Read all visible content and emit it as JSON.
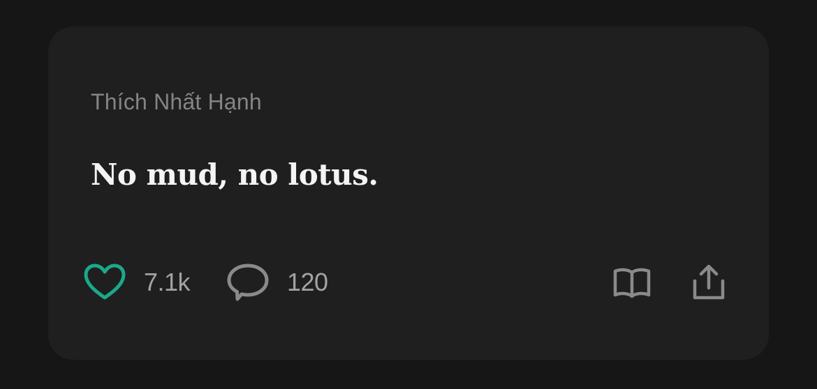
{
  "post": {
    "author": "Thích Nhất Hạnh",
    "quote": "No mud, no lotus.",
    "likes": {
      "icon": "heart-icon",
      "count": "7.1k",
      "color": "#1aa98a"
    },
    "comments": {
      "icon": "speech-bubble-icon",
      "count": "120"
    },
    "read": {
      "icon": "open-book-icon"
    },
    "share": {
      "icon": "share-upload-icon"
    }
  },
  "colors": {
    "background": "#161616",
    "card": "#1f1f1f",
    "author_text": "#858585",
    "quote_text": "#f4f4f4",
    "icon_gray": "#8a8a8a"
  }
}
